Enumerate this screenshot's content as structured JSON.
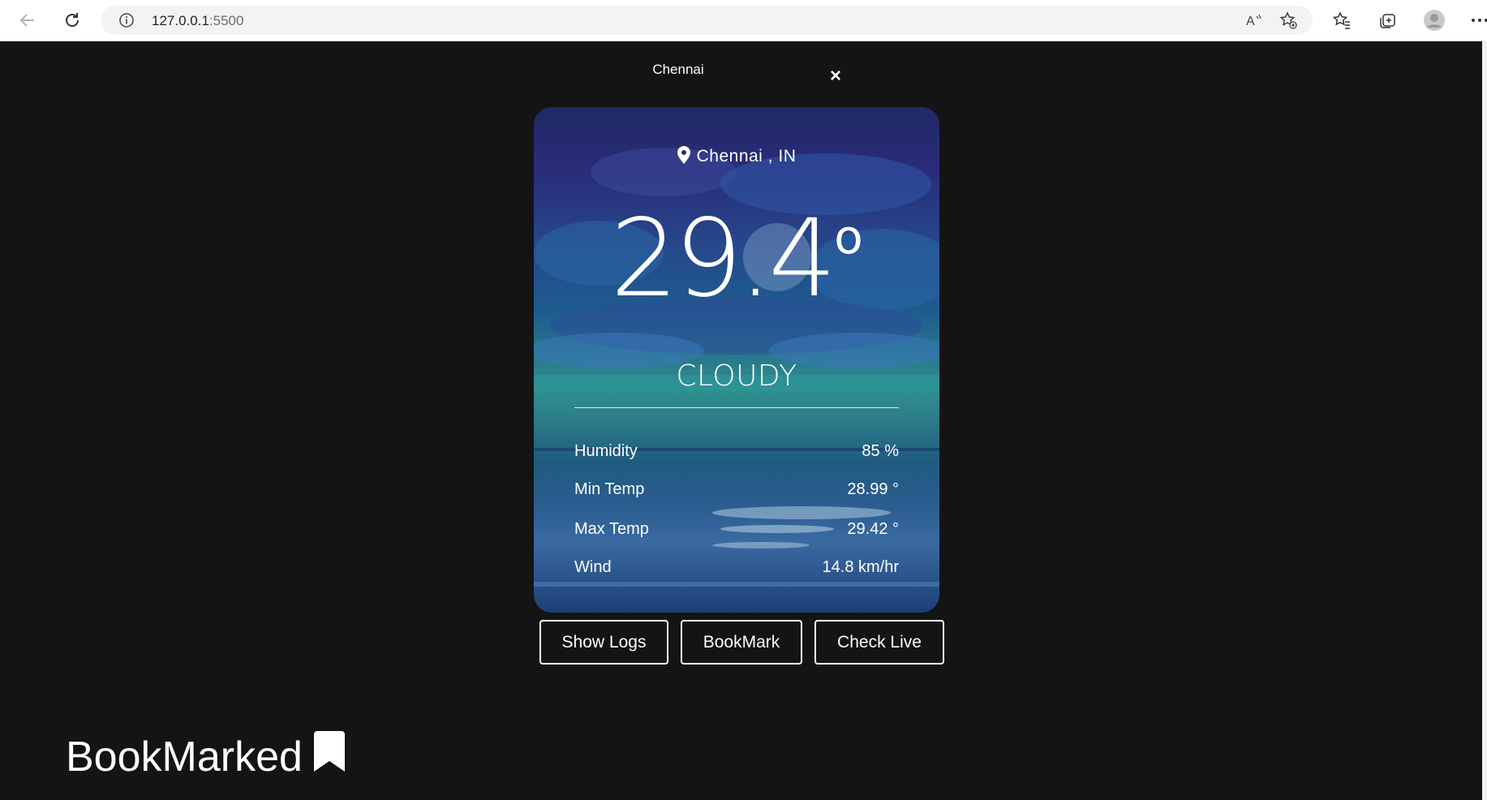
{
  "browser": {
    "url_host": "127.0.0.1",
    "url_port": ":5500",
    "icons": [
      "back-icon",
      "refresh-icon",
      "info-icon",
      "read-aloud-icon",
      "add-favorite-icon",
      "favorites-icon",
      "collections-icon",
      "profile-icon",
      "more-icon"
    ]
  },
  "modal": {
    "heading": "Chennai",
    "close_label": "×"
  },
  "weather": {
    "location": "Chennai , IN",
    "temperature": "29.4",
    "temperature_unit": "o",
    "condition": "CLOUDY",
    "stats": [
      {
        "label": "Humidity",
        "value": "85 %"
      },
      {
        "label": "Min Temp",
        "value": "28.99 °"
      },
      {
        "label": "Max Temp",
        "value": "29.42 °"
      },
      {
        "label": "Wind",
        "value": "14.8 km/hr"
      }
    ]
  },
  "actions": {
    "show_logs": "Show Logs",
    "bookmark": "BookMark",
    "check_live": "Check Live"
  },
  "bookmarks_section": {
    "title": "BookMarked"
  },
  "colors": {
    "page_background": "#141414",
    "text": "#ffffff"
  }
}
